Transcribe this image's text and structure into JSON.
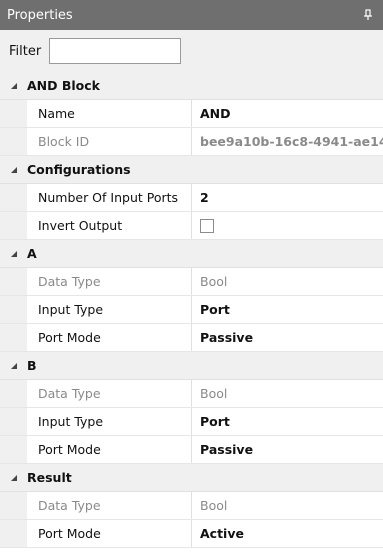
{
  "panel": {
    "title": "Properties"
  },
  "filter": {
    "label": "Filter",
    "value": ""
  },
  "sections": {
    "and_block": {
      "title": "AND Block",
      "name_label": "Name",
      "name_value": "AND",
      "block_id_label": "Block ID",
      "block_id_value": "bee9a10b-16c8-4941-ae14-"
    },
    "configurations": {
      "title": "Configurations",
      "num_inputs_label": "Number Of Input Ports",
      "num_inputs_value": "2",
      "invert_label": "Invert Output",
      "invert_checked": false
    },
    "a": {
      "title": "A",
      "data_type_label": "Data Type",
      "data_type_value": "Bool",
      "input_type_label": "Input Type",
      "input_type_value": "Port",
      "port_mode_label": "Port Mode",
      "port_mode_value": "Passive"
    },
    "b": {
      "title": "B",
      "data_type_label": "Data Type",
      "data_type_value": "Bool",
      "input_type_label": "Input Type",
      "input_type_value": "Port",
      "port_mode_label": "Port Mode",
      "port_mode_value": "Passive"
    },
    "result": {
      "title": "Result",
      "data_type_label": "Data Type",
      "data_type_value": "Bool",
      "port_mode_label": "Port Mode",
      "port_mode_value": "Active"
    }
  },
  "icons": {
    "pin": "pin-icon",
    "collapse": "collapse-triangle-icon"
  }
}
